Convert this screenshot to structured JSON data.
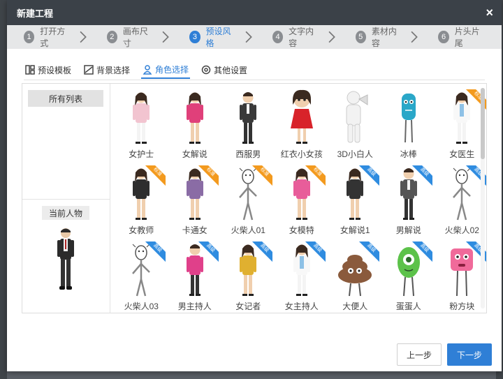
{
  "dialog": {
    "title": "新建工程",
    "close_label": "×"
  },
  "steps": [
    {
      "num": "1",
      "label": "打开方式",
      "active": false
    },
    {
      "num": "2",
      "label": "画布尺寸",
      "active": false
    },
    {
      "num": "3",
      "label": "预设风格",
      "active": true
    },
    {
      "num": "4",
      "label": "文字内容",
      "active": false
    },
    {
      "num": "5",
      "label": "素材内容",
      "active": false
    },
    {
      "num": "6",
      "label": "片头片尾",
      "active": false
    }
  ],
  "subtabs": [
    {
      "label": "预设模板",
      "icon": "template-icon",
      "active": false
    },
    {
      "label": "背景选择",
      "icon": "image-icon",
      "active": false
    },
    {
      "label": "角色选择",
      "icon": "person-icon",
      "active": true
    },
    {
      "label": "其他设置",
      "icon": "settings-icon",
      "active": false
    }
  ],
  "left": {
    "all_list": "所有列表",
    "current": "当前人物"
  },
  "badges": {
    "std": "标准",
    "pro": "高级"
  },
  "characters": [
    {
      "name": "女护士",
      "badge": "",
      "kind": "nurse",
      "color": "#f2c4d0"
    },
    {
      "name": "女解说",
      "badge": "",
      "kind": "woman",
      "color": "#e0407a"
    },
    {
      "name": "西服男",
      "badge": "",
      "kind": "suit",
      "color": "#3a3a3a"
    },
    {
      "name": "红衣小女孩",
      "badge": "",
      "kind": "girl",
      "color": "#d8232a"
    },
    {
      "name": "3D小白人",
      "badge": "",
      "kind": "white",
      "color": "#e8e8e8"
    },
    {
      "name": "冰棒",
      "badge": "",
      "kind": "blob",
      "color": "#2aa7c8"
    },
    {
      "name": "女医生",
      "badge": "std",
      "kind": "doctor",
      "color": "#dfeef7"
    },
    {
      "name": "女教师",
      "badge": "std",
      "kind": "woman",
      "color": "#2e2e2e"
    },
    {
      "name": "卡通女",
      "badge": "std",
      "kind": "woman",
      "color": "#8a6ca5"
    },
    {
      "name": "火柴人01",
      "badge": "std",
      "kind": "stick",
      "color": "#888888"
    },
    {
      "name": "女模特",
      "badge": "std",
      "kind": "woman",
      "color": "#e85d9a"
    },
    {
      "name": "女解说1",
      "badge": "pro",
      "kind": "woman",
      "color": "#333333"
    },
    {
      "name": "男解说",
      "badge": "pro",
      "kind": "suit",
      "color": "#555555"
    },
    {
      "name": "火柴人02",
      "badge": "pro",
      "kind": "stick",
      "color": "#888888"
    },
    {
      "name": "火柴人03",
      "badge": "pro",
      "kind": "stick",
      "color": "#888888"
    },
    {
      "name": "男主持人",
      "badge": "pro",
      "kind": "man",
      "color": "#e0408a"
    },
    {
      "name": "女记者",
      "badge": "pro",
      "kind": "woman",
      "color": "#e0b030"
    },
    {
      "name": "女主持人",
      "badge": "pro",
      "kind": "doctor",
      "color": "#e0e0e0"
    },
    {
      "name": "大便人",
      "badge": "pro",
      "kind": "poop",
      "color": "#8a5a3c"
    },
    {
      "name": "蛋蛋人",
      "badge": "pro",
      "kind": "egg",
      "color": "#5cc24a"
    },
    {
      "name": "粉方块",
      "badge": "pro",
      "kind": "block",
      "color": "#f06a9a"
    }
  ],
  "buttons": {
    "prev": "上一步",
    "next": "下一步"
  }
}
